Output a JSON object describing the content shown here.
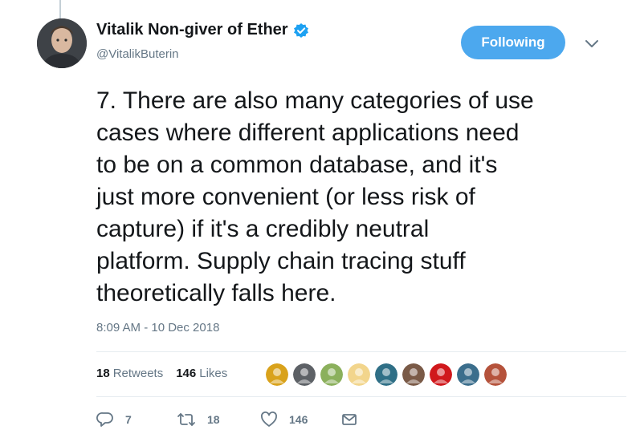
{
  "author": {
    "display_name": "Vitalik Non-giver of Ether",
    "handle": "@VitalikButerin",
    "avatar_icon": "person-avatar-icon",
    "verified_icon": "verified-badge-icon"
  },
  "follow_button": {
    "label": "Following"
  },
  "tweet": {
    "text": "7. There are also many categories of use\ncases where different applications need\nto be on a common database, and it's\njust more convenient (or less risk of\ncapture) if it's a credibly neutral\nplatform. Supply chain tracing stuff\ntheoretically falls here.",
    "timestamp": "8:09 AM - 10 Dec 2018"
  },
  "stats": {
    "retweets_count": "18",
    "retweets_label": "Retweets",
    "likes_count": "146",
    "likes_label": "Likes"
  },
  "likers": [
    {
      "icon": "liker-avatar-icon",
      "color": "#d9a21b"
    },
    {
      "icon": "liker-avatar-icon",
      "color": "#5d6166"
    },
    {
      "icon": "liker-avatar-icon",
      "color": "#8bb05c"
    },
    {
      "icon": "liker-avatar-icon",
      "color": "#f2d58c"
    },
    {
      "icon": "liker-avatar-icon",
      "color": "#2f6f86"
    },
    {
      "icon": "liker-avatar-icon",
      "color": "#7a5a47"
    },
    {
      "icon": "liker-avatar-icon",
      "color": "#d0181c"
    },
    {
      "icon": "liker-avatar-icon",
      "color": "#3b6e8c"
    },
    {
      "icon": "liker-avatar-icon",
      "color": "#b5523b"
    }
  ],
  "actions": {
    "reply_count": "7",
    "retweet_count": "18",
    "like_count": "146",
    "reply_icon": "reply-icon",
    "retweet_icon": "retweet-icon",
    "like_icon": "heart-icon",
    "message_icon": "direct-message-icon"
  },
  "colors": {
    "accent": "#1da1f2",
    "follow_bg": "#4ca8ee",
    "muted_text": "#657786"
  }
}
